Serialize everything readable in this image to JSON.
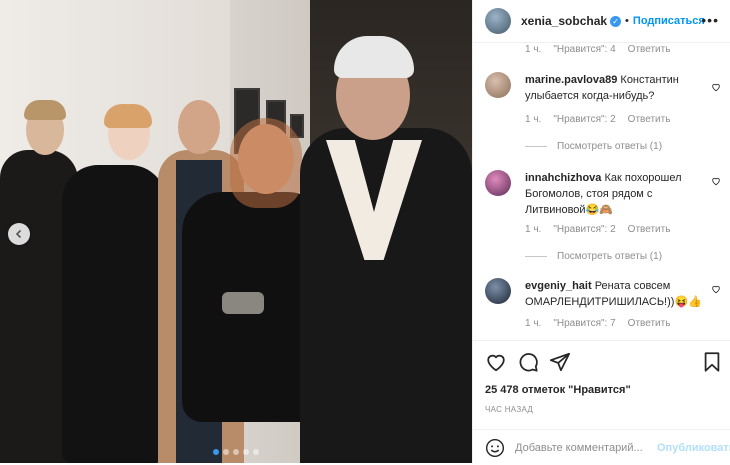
{
  "post": {
    "username": "xenia_sobchak",
    "separator": "•",
    "follow_label": "Подписаться",
    "more_label": "•••",
    "top_meta": {
      "time": "1 ч.",
      "likes": "\"Нравится\": 4",
      "reply": "Ответить"
    }
  },
  "comments": [
    {
      "user": "marine.pavlova89",
      "text": "Константин улыбается когда-нибудь?",
      "time": "1 ч.",
      "likes": "\"Нравится\": 2",
      "reply": "Ответить",
      "view": "Посмотреть ответы (1)",
      "avatar_color": "#b9a08c"
    },
    {
      "user": "innahchizhova",
      "text": "Как похорошел Богомолов, стоя рядом с Литвиновой😂🙈",
      "time": "1 ч.",
      "likes": "\"Нравится\": 2",
      "reply": "Ответить",
      "view": "Посмотреть ответы (1)",
      "avatar_color": "#a34b86"
    },
    {
      "user": "evgeniy_hait",
      "text": "Рената совсем ОМАРЛЕНДИТРИШИЛАСЬ!))😝👍",
      "time": "1 ч.",
      "likes": "\"Нравится\": 7",
      "reply": "Ответить",
      "avatar_color": "#3b4a5e"
    }
  ],
  "likes_text": "25 478 отметок \"Нравится\"",
  "time_ago": "ЧАС НАЗАД",
  "comment_placeholder": "Добавьте комментарий...",
  "publish_label": "Опубликовать",
  "carousel": {
    "dots": 5,
    "active_index": 0
  },
  "icons": [
    "heart-icon",
    "comment-icon",
    "share-icon",
    "bookmark-icon",
    "emoji-icon",
    "chevron-left-icon",
    "verified-icon"
  ]
}
